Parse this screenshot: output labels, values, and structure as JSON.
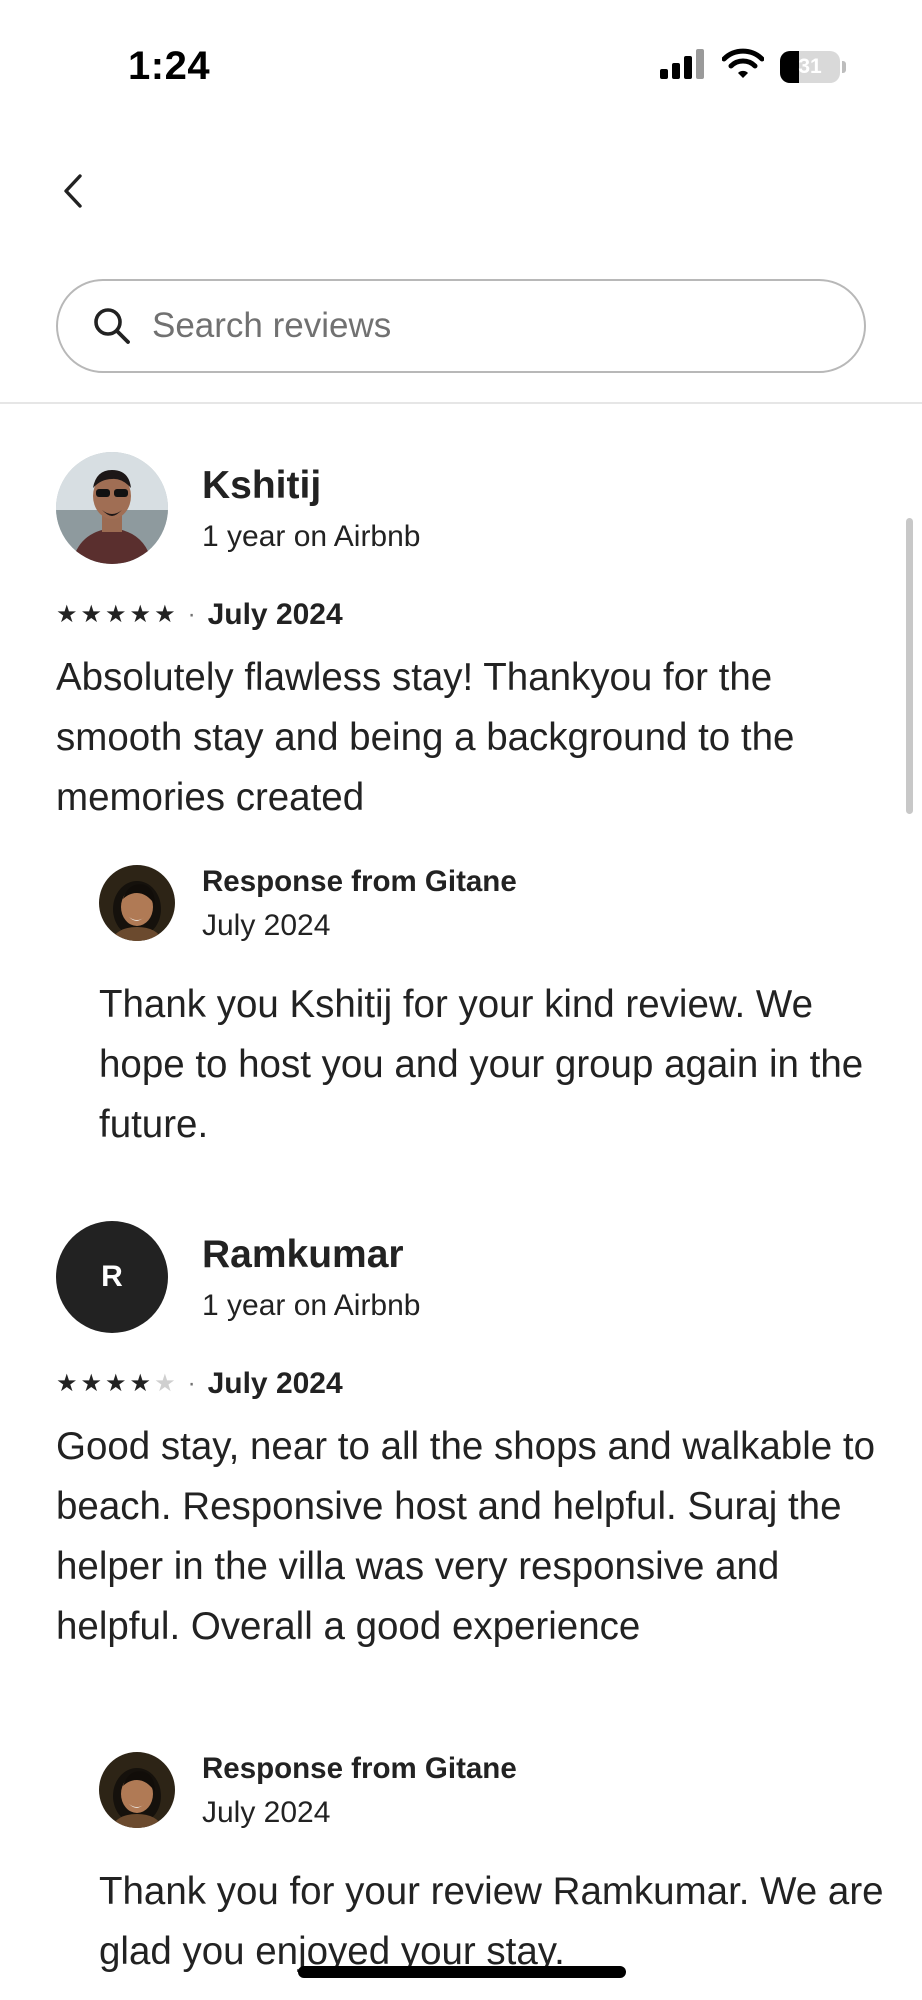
{
  "status_bar": {
    "time": "1:24",
    "battery": "31",
    "icons": [
      "cellular-signal-icon",
      "wifi-icon",
      "battery-icon"
    ]
  },
  "nav": {
    "back_icon": "chevron-left-icon"
  },
  "search": {
    "placeholder": "Search reviews",
    "icon": "search-icon"
  },
  "reviews": [
    {
      "name": "Kshitij",
      "tenure": "1 year on Airbnb",
      "rating": 5,
      "date": "July 2024",
      "text": "Absolutely flawless stay! Thankyou for the smooth stay and being a background to the memories created",
      "response": {
        "title": "Response from Gitane",
        "date": "July 2024",
        "text": "Thank you Kshitij for your kind review. We hope to host you and your group again in the future."
      }
    },
    {
      "name": "Ramkumar",
      "initial": "R",
      "tenure": "1 year on Airbnb",
      "rating": 4,
      "date": "July 2024",
      "text": "Good stay, near to all the shops and walkable to beach. Responsive host and helpful. Suraj the helper in the villa was very responsive and helpful. Overall a good experience",
      "response": {
        "title": "Response from Gitane",
        "date": "July 2024",
        "text": "Thank you for your review Ramkumar. We are glad you enjoyed your stay."
      }
    }
  ],
  "separator": "·",
  "colors": {
    "text": "#222222",
    "muted": "#717171",
    "border": "#b8b8b8",
    "star_off": "#cfcfcf"
  }
}
